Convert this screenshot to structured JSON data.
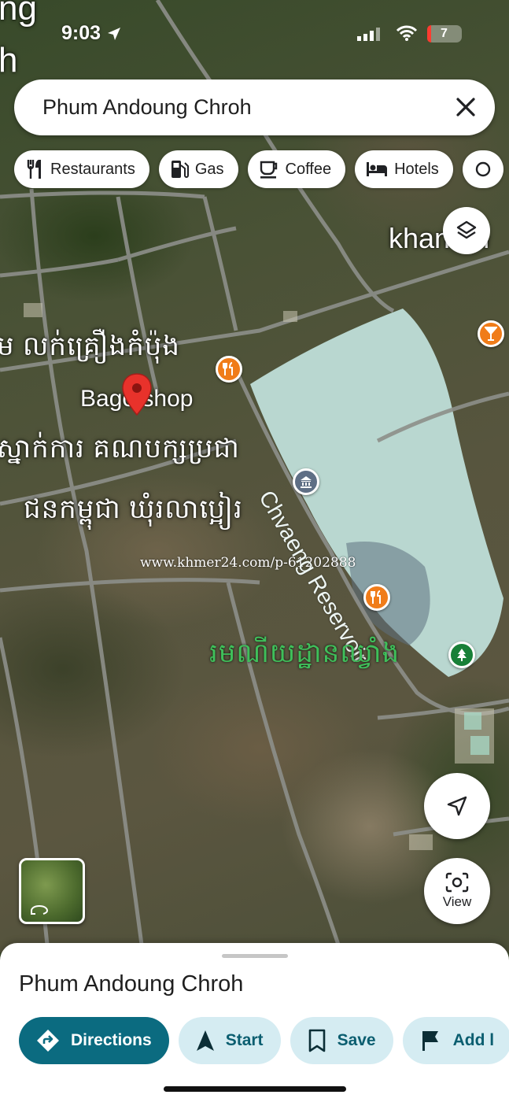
{
  "status_bar": {
    "time": "9:03",
    "battery": "7"
  },
  "search": {
    "query": "Phum Andoung Chroh"
  },
  "chips": [
    {
      "label": "Restaurants",
      "icon": "fork-knife-icon"
    },
    {
      "label": "Gas",
      "icon": "gas-station-icon"
    },
    {
      "label": "Coffee",
      "icon": "coffee-cup-icon"
    },
    {
      "label": "Hotels",
      "icon": "bed-icon"
    }
  ],
  "map": {
    "labels": {
      "corner_top": "ng",
      "corner_left": "h",
      "top_right": "khan  ah",
      "khmer_shop": "ម លក់គ្រឿងកំប៉ុង",
      "bago_shop": "Bago shop",
      "khmer_party_1": "ស្នាក់ការ គណបក្សប្រជា",
      "khmer_party_2": "ជនកម្ពុជា ឃុំរលាប្អៀរ",
      "watermark": "www.khmer24.com/p-61202888",
      "reservoir": "Chvaeng Reservoir",
      "khmer_park": "រមណីយដ្ឋានឈ្វាំង"
    },
    "colors": {
      "poi_food": "#f07c19",
      "poi_park": "#188038",
      "poi_museum": "#5f6f85",
      "reservoir": "#b9d7d0"
    }
  },
  "fabs": {
    "view_label": "View"
  },
  "sheet": {
    "title": "Phum Andoung Chroh",
    "actions": {
      "directions": "Directions",
      "start": "Start",
      "save": "Save",
      "add": "Add l"
    }
  }
}
